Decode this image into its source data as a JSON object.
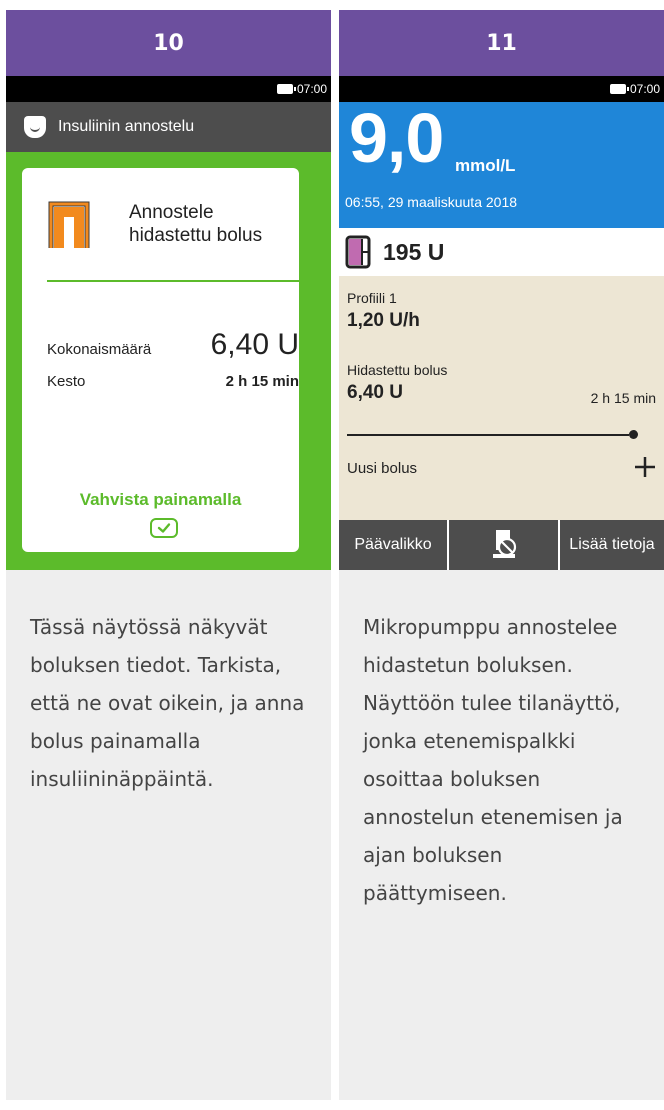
{
  "left": {
    "step_number": "10",
    "status_time": "07:00",
    "title": "Insuliinin annostelu",
    "card": {
      "heading": "Annostele\nhidastettu bolus",
      "total_label": "Kokonaismäärä",
      "total_value": "6,40 U",
      "duration_label": "Kesto",
      "duration_value": "2 h 15 min",
      "confirm_text": "Vahvista painamalla"
    },
    "caption": "Tässä näytössä näkyvät boluksen tiedot. Tarkista, että ne ovat oikein, ja anna bolus painamalla insuliininäppäintä."
  },
  "right": {
    "step_number": "11",
    "status_time": "07:00",
    "glucose_value": "9,0",
    "glucose_unit": "mmol/L",
    "glucose_time": "06:55, 29 maaliskuuta 2018",
    "reservoir_value": "195 U",
    "basal_profile_label": "Profiili 1",
    "basal_rate": "1,20 U/h",
    "bolus_label": "Hidastettu bolus",
    "bolus_amount": "6,40 U",
    "bolus_remaining": "2 h 15 min",
    "bolus_progress": 1.0,
    "new_bolus_label": "Uusi bolus",
    "left_softkey": "Päävalikko",
    "right_softkey": "Lisää tietoja",
    "caption": "Mikropumppu annostelee hidastetun boluksen. Näyttöön tulee tilanäyttö, jonka etenemispalkki osoittaa boluksen annostelun etenemisen ja ajan boluksen päättymiseen."
  },
  "colors": {
    "header_purple": "#6c4f9e",
    "confirm_green": "#5cbb2b",
    "glucose_blue": "#1f86d8",
    "status_beige": "#ede6d4",
    "extended_bolus_icon": "#f28a1e",
    "reservoir_pink": "#c06bb0"
  },
  "icons": {
    "title": "pump-icon",
    "extended_bolus": "extended-bolus-icon",
    "confirm": "check-icon",
    "reservoir": "reservoir-icon",
    "add": "plus-icon",
    "suspend": "pump-suspend-icon"
  }
}
